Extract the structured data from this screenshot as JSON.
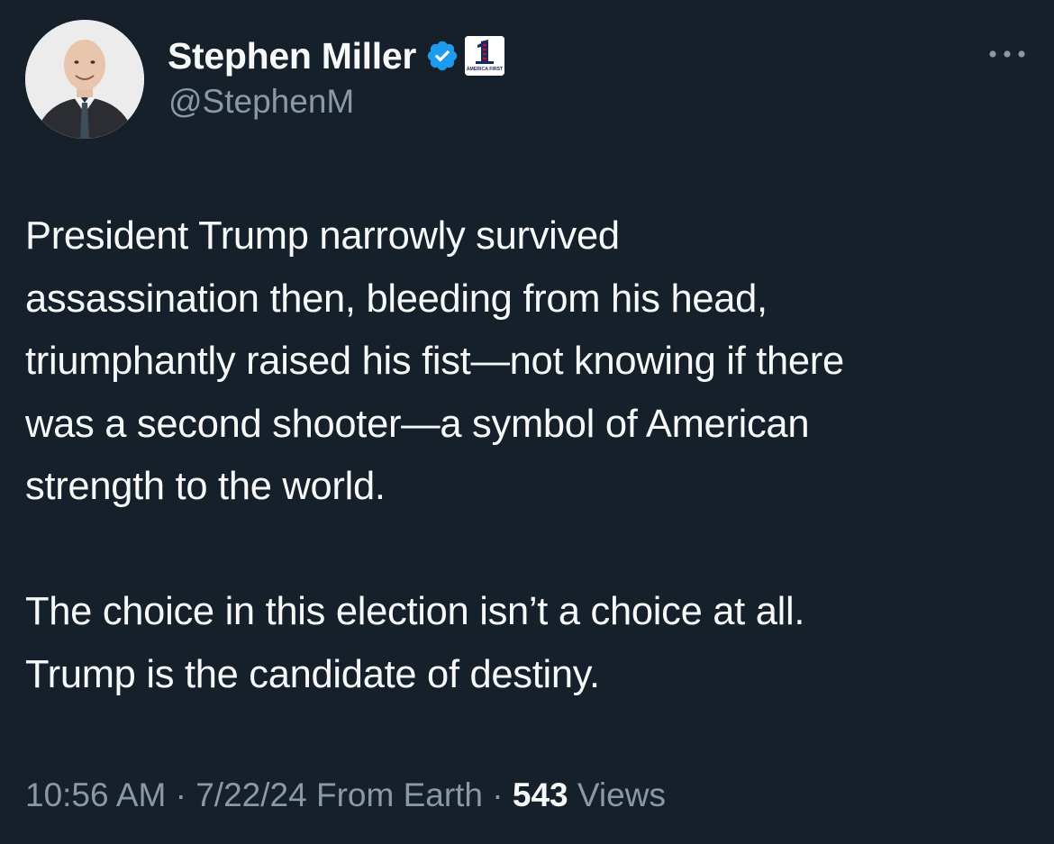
{
  "author": {
    "display_name": "Stephen Miller",
    "handle": "@StephenM",
    "verified": true,
    "affiliate_badge_text": "AMERICA FIRST"
  },
  "tweet": {
    "text_lines_p1": [
      "President Trump narrowly survived",
      "assassination then, bleeding from his head,",
      "triumphantly raised his fist—not knowing if there",
      "was a second shooter—a symbol of American",
      "strength to the world."
    ],
    "text_lines_p2": [
      "The choice in this election isn’t a choice at all.",
      "Trump is the candidate of destiny."
    ]
  },
  "meta": {
    "time": "10:56 AM",
    "separator": "·",
    "date": "7/22/24",
    "source": "From Earth",
    "views_count": "543",
    "views_label": "Views"
  },
  "colors": {
    "background": "#15202b",
    "text_primary": "#f7f9f9",
    "text_secondary": "#8b98a5",
    "verified_blue": "#1d9bf0"
  }
}
